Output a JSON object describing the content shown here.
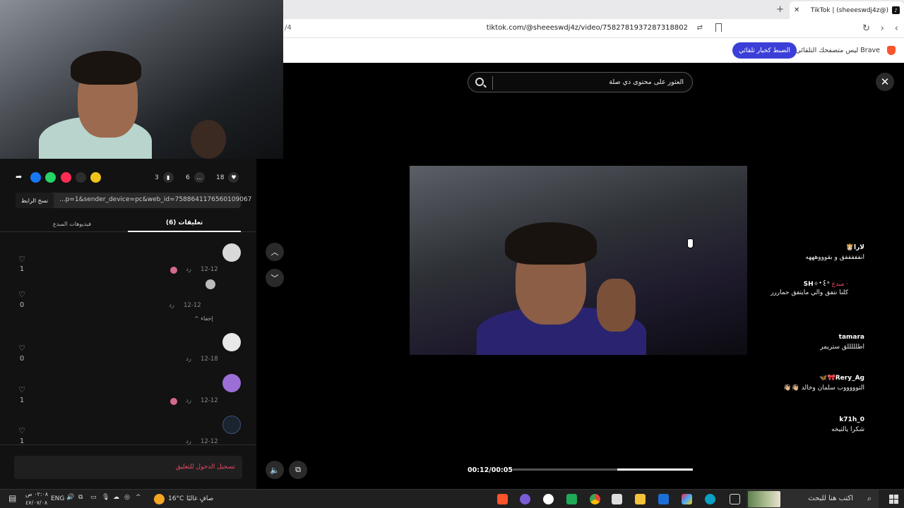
{
  "browser": {
    "tab_title": "(@sheeeswdj4z) | TikTok",
    "url": "tiktok.com/@sheeeswdj4z/video/7582781937287318802",
    "left_url_fragment": "/4",
    "infobar_text": "Brave ليس متصفحك التلقائي.",
    "infobar_button": "الضبط كخيار تلقائي"
  },
  "actions": {
    "likes": "18",
    "comments": "6",
    "saves": "3"
  },
  "link": {
    "copy_label": "نسخ الرابط",
    "url_text": "...p=1&sender_device=pc&web_id=7588641176560109067"
  },
  "tabs": {
    "comments": "تعليقات (6)",
    "creator_videos": "فيديوهات المبدع"
  },
  "comments": [
    {
      "name": "لارا👸🏻",
      "text": "انفففففق و بقوووهههه",
      "date": "12-12",
      "reply": "رد",
      "likes": "1"
    },
    {
      "name": "SH✧⁺꒰ᐢ",
      "badge": "· مبدع",
      "text": "كلنا نتفق والي مايتفق حماررر",
      "date": "12-12",
      "reply": "رد",
      "likes": "0"
    },
    {
      "name": "tamara",
      "text": "اطلللللق ستريمر",
      "date": "12-18",
      "reply": "رد",
      "likes": "0"
    },
    {
      "name": "Rery_Ag🎀🦋",
      "text": "التوووووب سلمان وخالد 👋🏼👋🏼",
      "date": "12-12",
      "reply": "رد",
      "likes": "1"
    },
    {
      "name": "k71h_0",
      "text": "شكرا يالتيخه",
      "date": "12-12",
      "reply": "رد",
      "likes": "1"
    }
  ],
  "hide_label": "إخفاء",
  "login_prompt": "تسجيل الدخول للتعليق",
  "video": {
    "search_placeholder": "العثور على محتوى ذي صلة",
    "time": "00:12/00:05",
    "progress": 0.42
  },
  "taskbar": {
    "search": "اكتب هنا للبحث",
    "weather": "صافٍ غالبًا",
    "temp": "16°C",
    "lang": "ENG",
    "time": "٠٢:٠٨ ص",
    "date": "٤٧/٠٧/٠٨"
  }
}
